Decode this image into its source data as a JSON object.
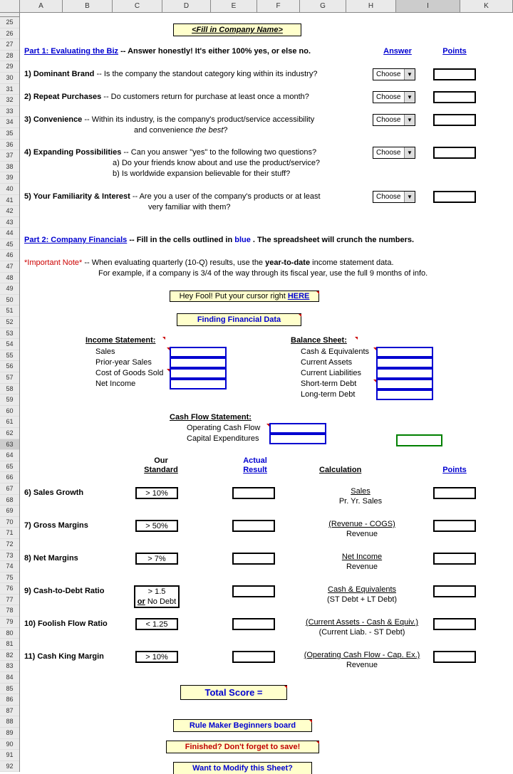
{
  "columns": [
    "A",
    "B",
    "C",
    "D",
    "E",
    "F",
    "G",
    "H",
    "I",
    "K"
  ],
  "row_start": 25,
  "row_end": 92,
  "selected_cell": "I63",
  "title": "<Fill in Company Name>",
  "part1": {
    "heading": "Part 1:  Evaluating the Biz",
    "tail": " -- Answer honestly!  It's either 100% yes, or else no.",
    "answer_hdr": "Answer",
    "points_hdr": "Points",
    "q1_num": "1)",
    "q1_title": " Dominant Brand ",
    "q1_text": "-- Is the company the standout category king within its industry?",
    "q2_num": "2)",
    "q2_title": " Repeat Purchases ",
    "q2_text": "-- Do customers return for purchase at least once a month?",
    "q3_num": "3)",
    "q3_title": " Convenience ",
    "q3_text": "-- Within its industry, is the company's product/service accessibility",
    "q3_line2a": "and convenience ",
    "q3_line2b": "the best",
    "q3_line2c": "?",
    "q4_num": "4)",
    "q4_title": " Expanding Possibilities ",
    "q4_text": "-- Can you answer \"yes\" to the following two questions?",
    "q4_a": "a) Do your friends know about and use the product/service?",
    "q4_b": "b) Is worldwide expansion believable for their stuff?",
    "q5_num": "5)",
    "q5_title": " Your Familiarity & Interest ",
    "q5_text": "-- Are you a user of the company's products or at least",
    "q5_line2": "very familiar with them?",
    "choose": "Choose"
  },
  "part2": {
    "heading": "Part 2:  Company Financials",
    "tail1": " -- Fill in the cells outlined in ",
    "blue_word": "blue",
    "tail2": ". The spreadsheet will crunch the numbers.",
    "note_label": "*Important Note*",
    "note1": " -- When evaluating quarterly (10-Q) results, use the ",
    "note_bold": "year-to-date",
    "note1b": " income statement data.",
    "note2": "For example, if a company is 3/4 of the way through its fiscal year, use the full 9 months of info.",
    "hey1": "Hey Fool!  Put your cursor right ",
    "hey2": "HERE",
    "finding": "Finding Financial Data"
  },
  "fin": {
    "income_hdr": "Income Statement:",
    "income_rows": [
      "Sales",
      "Prior-year Sales",
      "Cost of Goods Sold",
      "Net Income"
    ],
    "balance_hdr": "Balance Sheet:",
    "balance_rows": [
      "Cash & Equivalents",
      "Current Assets",
      "Current Liabilities",
      "Short-term Debt",
      "Long-term Debt"
    ],
    "cashflow_hdr": "Cash Flow Statement:",
    "cashflow_rows": [
      "Operating Cash Flow",
      "Capital Expenditures"
    ]
  },
  "metrics": {
    "our_std_hdr": "Our\nStandard",
    "our_std_hdr1": "Our",
    "our_std_hdr2": "Standard",
    "actual_hdr1": "Actual",
    "actual_hdr2": "Result",
    "calc_hdr": "Calculation",
    "points_hdr": "Points",
    "r6": {
      "label": "6)  Sales Growth",
      "std": "> 10%",
      "calc1": "Sales",
      "calc2": "Pr. Yr. Sales"
    },
    "r7": {
      "label": "7)  Gross Margins",
      "std": "> 50%",
      "calc1": "(Revenue - COGS)",
      "calc2": "Revenue"
    },
    "r8": {
      "label": "8)  Net Margins",
      "std": "> 7%",
      "calc1": "Net Income",
      "calc2": "Revenue"
    },
    "r9": {
      "label": "9)  Cash-to-Debt Ratio",
      "std": "> 1.5",
      "std2a": "or",
      "std2b": " No Debt",
      "calc1": "Cash & Equivalents",
      "calc2": "(ST Debt + LT Debt)"
    },
    "r10": {
      "label": "10)  Foolish Flow Ratio",
      "std": "< 1.25",
      "calc1": "(Current Assets - Cash & Equiv.)",
      "calc2": "(Current Liab. - ST Debt)"
    },
    "r11": {
      "label": "11) Cash King Margin",
      "std": "> 10%",
      "calc1": "(Operating Cash Flow - Cap. Ex.)",
      "calc2": "Revenue"
    }
  },
  "footer": {
    "total": "Total Score =",
    "b1": "Rule Maker Beginners board",
    "b2": "Finished?  Don't forget to save!",
    "b3": "Want to Modify this Sheet?"
  }
}
